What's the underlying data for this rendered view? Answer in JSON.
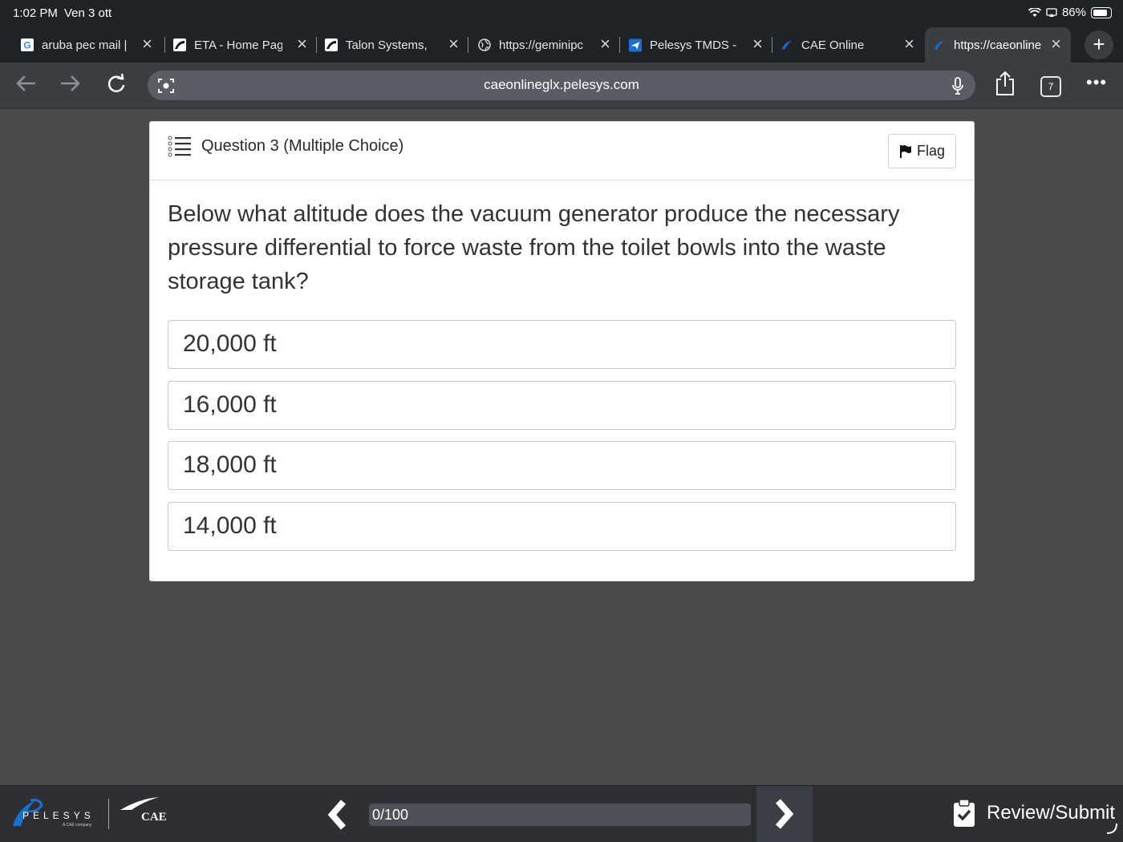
{
  "status_bar": {
    "time": "1:02 PM",
    "date": "Ven 3 ott",
    "battery": "86%"
  },
  "tabs": [
    {
      "title": "aruba pec mail |",
      "icon": "google-icon"
    },
    {
      "title": "ETA - Home Pag",
      "icon": "eta-icon"
    },
    {
      "title": "Talon Systems,",
      "icon": "talon-icon"
    },
    {
      "title": "https://geminipc",
      "icon": "globe-icon"
    },
    {
      "title": "Pelesys TMDS -",
      "icon": "plane-icon"
    },
    {
      "title": "CAE Online",
      "icon": "pelesys-icon"
    },
    {
      "title": "https://caeonline",
      "icon": "pelesys-icon",
      "active": true
    }
  ],
  "new_tab_label": "+",
  "toolbar": {
    "url": "caeonlineglx.pelesys.com",
    "tab_count": "7"
  },
  "question": {
    "header": "Question 3 (Multiple Choice)",
    "flag_label": "Flag",
    "text": "Below what altitude does the vacuum generator produce the necessary pressure differential to force waste from the toilet bowls into the waste storage tank?",
    "options": [
      {
        "label": "20,000 ft"
      },
      {
        "label": "16,000 ft"
      },
      {
        "label": "18,000 ft"
      },
      {
        "label": "14,000 ft"
      }
    ]
  },
  "footer": {
    "pelesys_logo_text": "PELESYS",
    "pelesys_tagline": "A CAE company",
    "cae_logo_text": "CAE",
    "progress_text": "0/100",
    "progress_fraction": 0,
    "review_label": "Review/Submit"
  },
  "colors": {
    "page_bg": "#4a4a4a",
    "chrome_bg": "#1f2227",
    "accent": "#1a6fd1",
    "card_bg": "#ffffff"
  }
}
